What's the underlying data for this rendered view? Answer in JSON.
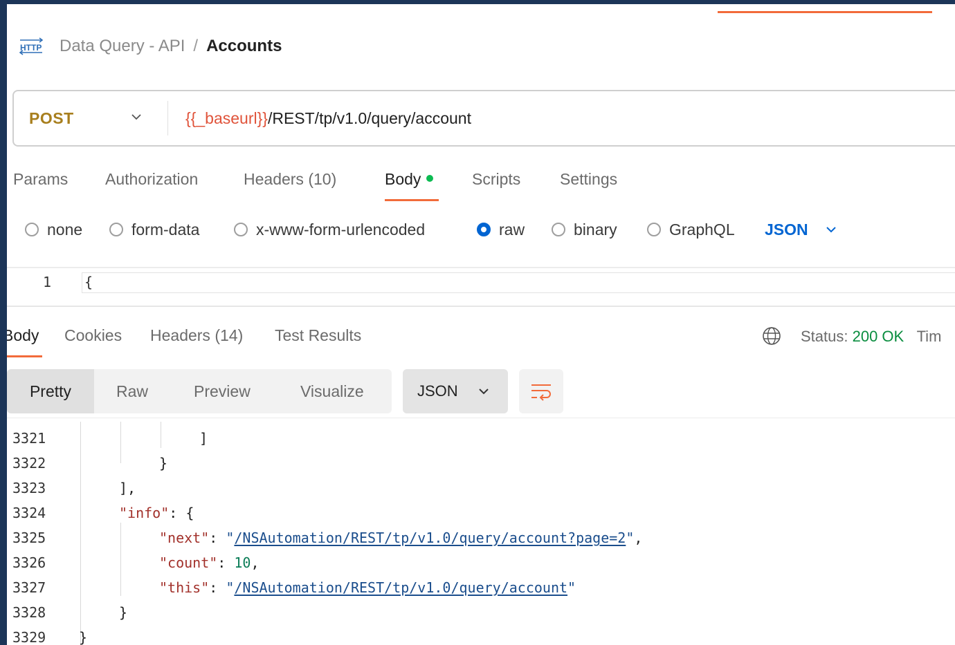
{
  "breadcrumb": {
    "icon": "http-request-icon",
    "collection": "Data Query - API",
    "separator": "/",
    "current": "Accounts"
  },
  "request": {
    "method": "POST",
    "url_variable": "{{_baseurl}}",
    "url_path": "/REST/tp/v1.0/query/account",
    "tabs": [
      {
        "label": "Params"
      },
      {
        "label": "Authorization"
      },
      {
        "label": "Headers (10)"
      },
      {
        "label": "Body"
      },
      {
        "label": "Scripts"
      },
      {
        "label": "Settings"
      }
    ],
    "active_tab": "Body",
    "body_types": [
      {
        "label": "none"
      },
      {
        "label": "form-data"
      },
      {
        "label": "x-www-form-urlencoded"
      },
      {
        "label": "raw"
      },
      {
        "label": "binary"
      },
      {
        "label": "GraphQL"
      }
    ],
    "selected_body_type": "raw",
    "format": "JSON",
    "editor": {
      "line": "1",
      "text": "{"
    }
  },
  "response": {
    "tabs": [
      {
        "label": "Body"
      },
      {
        "label": "Cookies"
      },
      {
        "label": "Headers (14)"
      },
      {
        "label": "Test Results"
      }
    ],
    "status_label": "Status:",
    "status_value": "200 OK",
    "time_label": "Tim",
    "views": [
      {
        "label": "Pretty"
      },
      {
        "label": "Raw"
      },
      {
        "label": "Preview"
      },
      {
        "label": "Visualize"
      }
    ],
    "format": "JSON",
    "lines": [
      {
        "num": "3321",
        "text": "]"
      },
      {
        "num": "3322",
        "text": "}"
      },
      {
        "num": "3323",
        "text": "],"
      },
      {
        "num": "3324",
        "key": "\"info\"",
        "rest": ": {"
      },
      {
        "num": "3325",
        "key": "\"next\"",
        "colon": ": ",
        "q1": "\"",
        "url": "/NSAutomation/REST/tp/v1.0/query/account?page=2",
        "q2": "\"",
        "tail": ","
      },
      {
        "num": "3326",
        "key": "\"count\"",
        "colon": ": ",
        "number": "10",
        "tail": ","
      },
      {
        "num": "3327",
        "key": "\"this\"",
        "colon": ": ",
        "q1": "\"",
        "url": "/NSAutomation/REST/tp/v1.0/query/account",
        "q2": "\""
      },
      {
        "num": "3328",
        "text": "}"
      },
      {
        "num": "3329",
        "text": "}"
      }
    ]
  },
  "colors": {
    "accent": "#f26b3a",
    "method": "#a87f1e",
    "link": "#0265d2",
    "status_ok": "#0a8d3f"
  }
}
